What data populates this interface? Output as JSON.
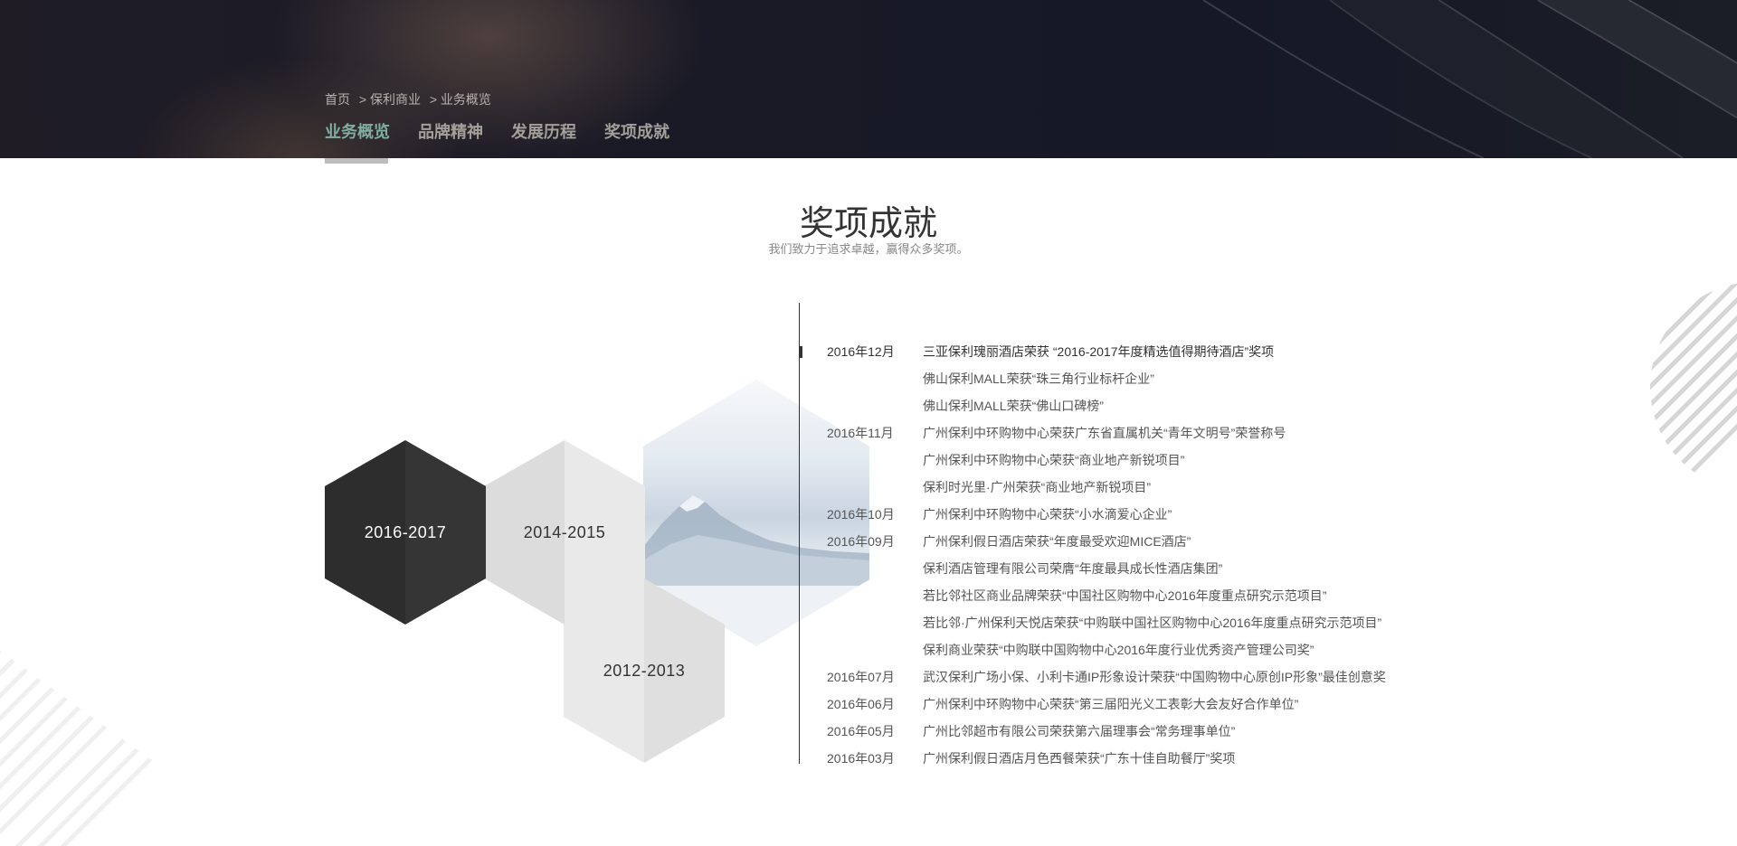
{
  "breadcrumb": [
    "首页",
    "> 保利商业",
    "> 业务概览"
  ],
  "tabs": [
    {
      "label": "业务概览",
      "active": true
    },
    {
      "label": "品牌精神",
      "active": false
    },
    {
      "label": "发展历程",
      "active": false
    },
    {
      "label": "奖项成就",
      "active": false
    }
  ],
  "section": {
    "title": "奖项成就",
    "subtitle": "我们致力于追求卓越，赢得众多奖项。"
  },
  "year_groups": [
    "2016-2017",
    "2014-2015",
    "2012-2013"
  ],
  "colors": {
    "accent": "#7faea1",
    "dark_hex": "#2d2d2d",
    "light_hex": "#e9e9e9"
  },
  "awards": [
    {
      "date": "2016年12月",
      "text": "三亚保利瑰丽酒店荣获 “2016-2017年度精选值得期待酒店”奖项"
    },
    {
      "date": "",
      "text": "佛山保利MALL荣获“珠三角行业标杆企业”"
    },
    {
      "date": "",
      "text": "佛山保利MALL荣获“佛山口碑榜”"
    },
    {
      "date": "2016年11月",
      "text": "广州保利中环购物中心荣获广东省直属机关“青年文明号”荣誉称号"
    },
    {
      "date": "",
      "text": "广州保利中环购物中心荣获“商业地产新锐项目”"
    },
    {
      "date": "",
      "text": "保利时光里·广州荣获“商业地产新锐项目”"
    },
    {
      "date": "2016年10月",
      "text": "广州保利中环购物中心荣获“小水滴爱心企业”"
    },
    {
      "date": "2016年09月",
      "text": "广州保利假日酒店荣获“年度最受欢迎MICE酒店”"
    },
    {
      "date": "",
      "text": "保利酒店管理有限公司荣膺“年度最具成长性酒店集团”"
    },
    {
      "date": "",
      "text": "若比邻社区商业品牌荣获“中国社区购物中心2016年度重点研究示范项目”"
    },
    {
      "date": "",
      "text": "若比邻·广州保利天悦店荣获“中购联中国社区购物中心2016年度重点研究示范项目”"
    },
    {
      "date": "",
      "text": "保利商业荣获“中购联中国购物中心2016年度行业优秀资产管理公司奖”"
    },
    {
      "date": "2016年07月",
      "text": "武汉保利广场小保、小利卡通IP形象设计荣获“中国购物中心原创IP形象”最佳创意奖"
    },
    {
      "date": "2016年06月",
      "text": "广州保利中环购物中心荣获“第三届阳光义工表彰大会友好合作单位”"
    },
    {
      "date": "2016年05月",
      "text": "广州比邻超市有限公司荣获第六届理事会“常务理事单位”"
    },
    {
      "date": "2016年03月",
      "text": "广州保利假日酒店月色西餐荣获“广东十佳自助餐厅”奖项"
    }
  ]
}
